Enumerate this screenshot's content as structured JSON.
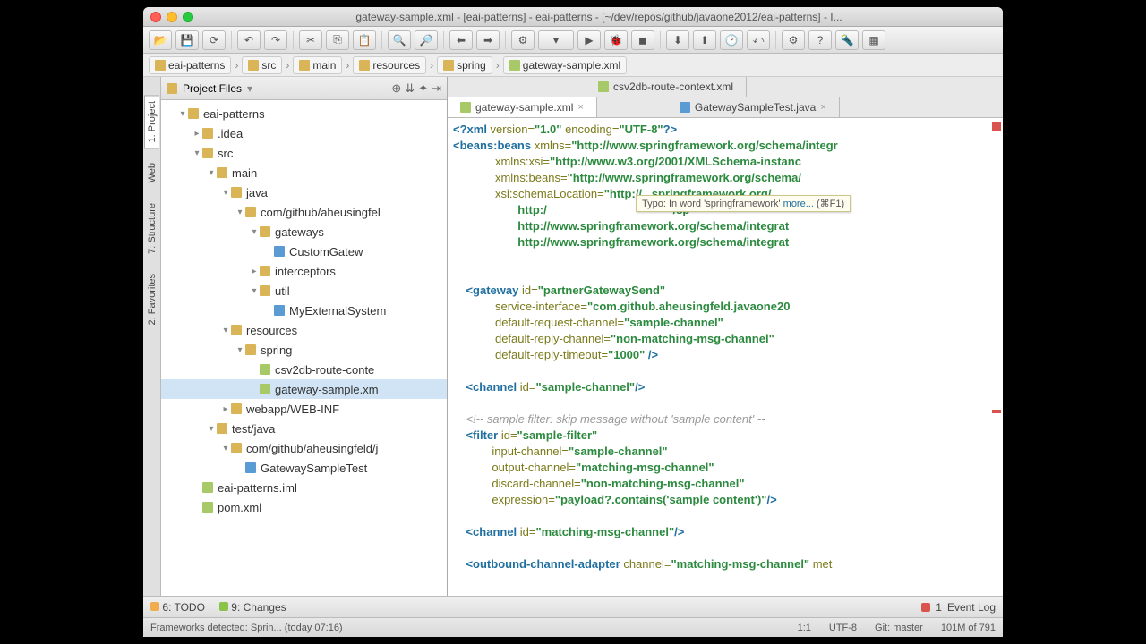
{
  "window": {
    "title": "gateway-sample.xml - [eai-patterns] - eai-patterns - [~/dev/repos/github/javaone2012/eai-patterns] - I..."
  },
  "breadcrumb": {
    "items": [
      "eai-patterns",
      "src",
      "main",
      "resources",
      "spring",
      "gateway-sample.xml"
    ]
  },
  "project_panel": {
    "title": "Project Files"
  },
  "tree": [
    {
      "depth": 1,
      "exp": true,
      "icon": "folder",
      "label": "eai-patterns"
    },
    {
      "depth": 2,
      "exp": false,
      "icon": "folder",
      "label": ".idea"
    },
    {
      "depth": 2,
      "exp": true,
      "icon": "folder",
      "label": "src"
    },
    {
      "depth": 3,
      "exp": true,
      "icon": "folder",
      "label": "main"
    },
    {
      "depth": 4,
      "exp": true,
      "icon": "folder",
      "label": "java"
    },
    {
      "depth": 5,
      "exp": true,
      "icon": "folder",
      "label": "com/github/aheusingfel"
    },
    {
      "depth": 6,
      "exp": true,
      "icon": "folder",
      "label": "gateways"
    },
    {
      "depth": 7,
      "exp": null,
      "icon": "java",
      "label": "CustomGatew"
    },
    {
      "depth": 6,
      "exp": false,
      "icon": "folder",
      "label": "interceptors"
    },
    {
      "depth": 6,
      "exp": true,
      "icon": "folder",
      "label": "util"
    },
    {
      "depth": 7,
      "exp": null,
      "icon": "java",
      "label": "MyExternalSystem"
    },
    {
      "depth": 4,
      "exp": true,
      "icon": "folder",
      "label": "resources"
    },
    {
      "depth": 5,
      "exp": true,
      "icon": "folder",
      "label": "spring"
    },
    {
      "depth": 6,
      "exp": null,
      "icon": "xml",
      "label": "csv2db-route-conte"
    },
    {
      "depth": 6,
      "exp": null,
      "icon": "xml",
      "label": "gateway-sample.xm",
      "sel": true
    },
    {
      "depth": 4,
      "exp": false,
      "icon": "folder",
      "label": "webapp/WEB-INF"
    },
    {
      "depth": 3,
      "exp": true,
      "icon": "folder",
      "label": "test/java"
    },
    {
      "depth": 4,
      "exp": true,
      "icon": "folder",
      "label": "com/github/aheusingfeld/j"
    },
    {
      "depth": 5,
      "exp": null,
      "icon": "java",
      "label": "GatewaySampleTest"
    },
    {
      "depth": 2,
      "exp": null,
      "icon": "xml",
      "label": "eai-patterns.iml"
    },
    {
      "depth": 2,
      "exp": null,
      "icon": "xml",
      "label": "pom.xml"
    }
  ],
  "editor_tabs": {
    "row1": [
      {
        "label": "csv2db-route-context.xml",
        "icon": "xml",
        "active": false
      }
    ],
    "row2": [
      {
        "label": "gateway-sample.xml",
        "icon": "xml",
        "active": true,
        "close": true
      },
      {
        "label": "GatewaySampleTest.java",
        "icon": "java",
        "active": false,
        "close": true
      }
    ]
  },
  "hint": {
    "prefix": "Typo: In word 'springframework' ",
    "link": "more...",
    "suffix": " (⌘F1)"
  },
  "code_lines": [
    [
      {
        "t": "tag",
        "v": "<?xml "
      },
      {
        "t": "attr",
        "v": "version="
      },
      {
        "t": "str",
        "v": "\"1.0\""
      },
      {
        "t": "attr",
        "v": " encoding="
      },
      {
        "t": "str",
        "v": "\"UTF-8\""
      },
      {
        "t": "tag",
        "v": "?>"
      }
    ],
    [
      {
        "t": "tag",
        "v": "<beans:beans "
      },
      {
        "t": "attr",
        "v": "xmlns="
      },
      {
        "t": "str",
        "v": "\"http://www.springframework.org/schema/integr"
      }
    ],
    [
      {
        "t": "",
        "v": "             "
      },
      {
        "t": "attr",
        "v": "xmlns:xsi="
      },
      {
        "t": "str",
        "v": "\"http://www.w3.org/2001/XMLSchema-instanc"
      }
    ],
    [
      {
        "t": "",
        "v": "             "
      },
      {
        "t": "attr",
        "v": "xmlns:beans="
      },
      {
        "t": "str",
        "v": "\"http://www.springframework.org/schema/"
      }
    ],
    [
      {
        "t": "",
        "v": "             "
      },
      {
        "t": "attr",
        "v": "xsi:schemaLocation="
      },
      {
        "t": "str",
        "v": "\"http://...springframework.org/"
      }
    ],
    [
      {
        "t": "",
        "v": "                    "
      },
      {
        "t": "str",
        "v": "http:/                                       /sp"
      }
    ],
    [
      {
        "t": "",
        "v": "                    "
      },
      {
        "t": "str",
        "v": "http://www.springframework.org/schema/integrat"
      }
    ],
    [
      {
        "t": "",
        "v": "                    "
      },
      {
        "t": "str",
        "v": "http://www.springframework.org/schema/integrat"
      }
    ],
    [],
    [],
    [
      {
        "t": "",
        "v": "    "
      },
      {
        "t": "tag",
        "v": "<gateway "
      },
      {
        "t": "attr",
        "v": "id="
      },
      {
        "t": "str",
        "v": "\"partnerGatewaySend\""
      }
    ],
    [
      {
        "t": "",
        "v": "             "
      },
      {
        "t": "attr",
        "v": "service-interface="
      },
      {
        "t": "str",
        "v": "\"com.github.aheusingfeld.javaone20"
      }
    ],
    [
      {
        "t": "",
        "v": "             "
      },
      {
        "t": "attr",
        "v": "default-request-channel="
      },
      {
        "t": "str",
        "v": "\"sample-channel\""
      }
    ],
    [
      {
        "t": "",
        "v": "             "
      },
      {
        "t": "attr",
        "v": "default-reply-channel="
      },
      {
        "t": "str",
        "v": "\"non-matching-msg-channel\""
      }
    ],
    [
      {
        "t": "",
        "v": "             "
      },
      {
        "t": "attr",
        "v": "default-reply-timeout="
      },
      {
        "t": "str",
        "v": "\"1000\""
      },
      {
        "t": "tag",
        "v": " />"
      }
    ],
    [],
    [
      {
        "t": "",
        "v": "    "
      },
      {
        "t": "tag",
        "v": "<channel "
      },
      {
        "t": "attr",
        "v": "id="
      },
      {
        "t": "str",
        "v": "\"sample-channel\""
      },
      {
        "t": "tag",
        "v": "/>"
      }
    ],
    [],
    [
      {
        "t": "",
        "v": "    "
      },
      {
        "t": "comment",
        "v": "<!-- sample filter: skip message without 'sample content' --"
      }
    ],
    [
      {
        "t": "",
        "v": "    "
      },
      {
        "t": "tag",
        "v": "<filter "
      },
      {
        "t": "attr",
        "v": "id="
      },
      {
        "t": "str",
        "v": "\"sample-filter\""
      }
    ],
    [
      {
        "t": "",
        "v": "            "
      },
      {
        "t": "attr",
        "v": "input-channel="
      },
      {
        "t": "str",
        "v": "\"sample-channel\""
      }
    ],
    [
      {
        "t": "",
        "v": "            "
      },
      {
        "t": "attr",
        "v": "output-channel="
      },
      {
        "t": "str",
        "v": "\"matching-msg-channel\""
      }
    ],
    [
      {
        "t": "",
        "v": "            "
      },
      {
        "t": "attr",
        "v": "discard-channel="
      },
      {
        "t": "str",
        "v": "\"non-matching-msg-channel\""
      }
    ],
    [
      {
        "t": "",
        "v": "            "
      },
      {
        "t": "attr",
        "v": "expression="
      },
      {
        "t": "str",
        "v": "\"payload?.contains('sample content')\""
      },
      {
        "t": "tag",
        "v": "/>"
      }
    ],
    [],
    [
      {
        "t": "",
        "v": "    "
      },
      {
        "t": "tag",
        "v": "<channel "
      },
      {
        "t": "attr",
        "v": "id="
      },
      {
        "t": "str",
        "v": "\"matching-msg-channel\""
      },
      {
        "t": "tag",
        "v": "/>"
      }
    ],
    [],
    [
      {
        "t": "",
        "v": "    "
      },
      {
        "t": "tag",
        "v": "<outbound-channel-adapter "
      },
      {
        "t": "attr",
        "v": "channel="
      },
      {
        "t": "str",
        "v": "\"matching-msg-channel\""
      },
      {
        "t": "attr",
        "v": " met"
      }
    ]
  ],
  "bottom": {
    "todo": "6: TODO",
    "changes": "9: Changes",
    "eventlog": "Event Log",
    "eventcount": "1"
  },
  "status": {
    "frameworks": "Frameworks detected: Sprin... (today 07:16)",
    "caret": "1:1",
    "encoding": "UTF-8",
    "git": "Git: master",
    "mem": "101M of 791"
  },
  "side_tabs": {
    "project": "1: Project",
    "web": "Web",
    "structure": "7: Structure",
    "favorites": "2: Favorites"
  }
}
